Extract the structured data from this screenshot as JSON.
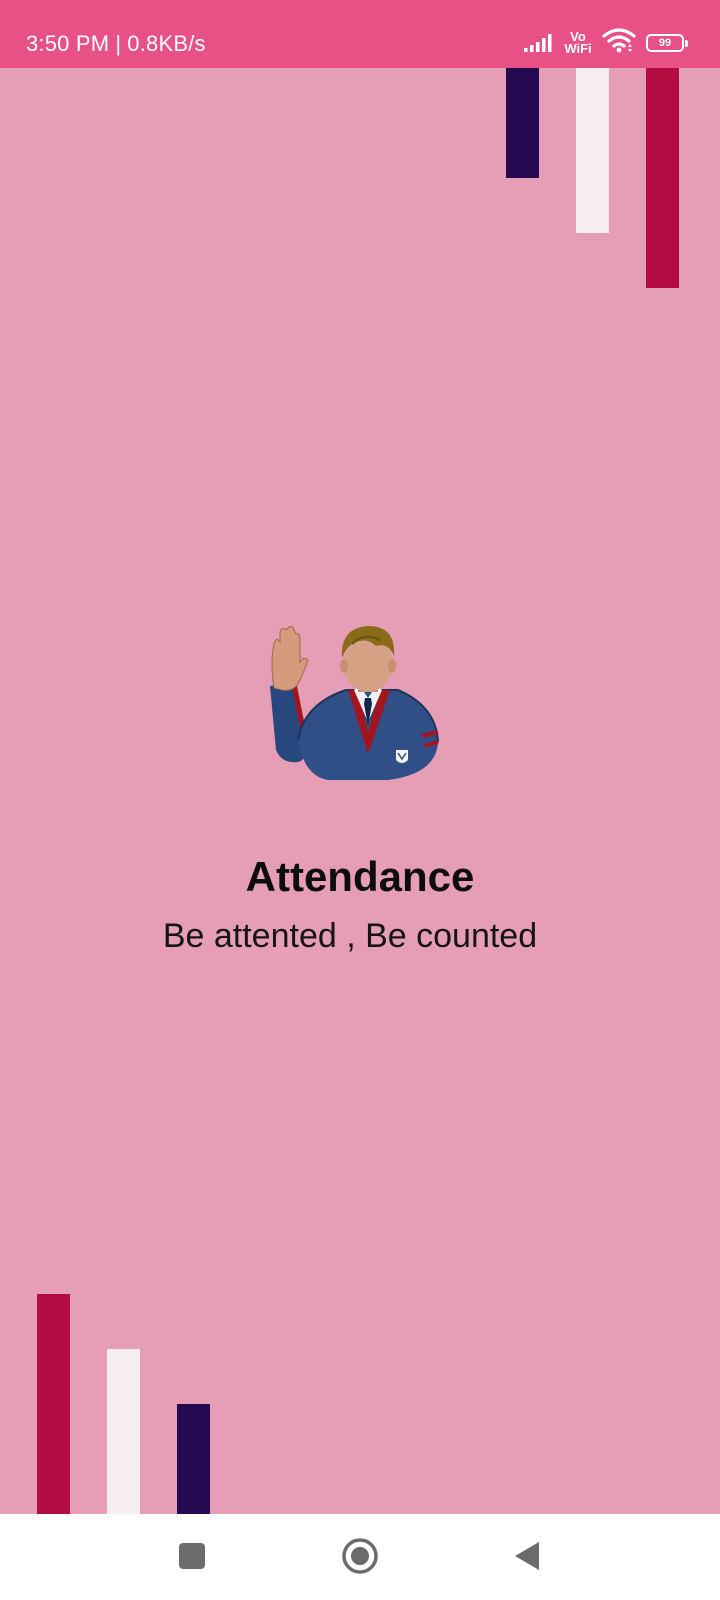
{
  "status_bar": {
    "time": "3:50 PM",
    "separator": "|",
    "speed": "0.8KB/s",
    "vowifi_top": "Vo",
    "vowifi_bottom": "WiFi",
    "battery": "99",
    "icons": [
      "signal-icon",
      "vowifi-icon",
      "wifi-icon",
      "battery-icon"
    ],
    "background": "#e85185"
  },
  "splash": {
    "title": "Attendance",
    "subtitle": "Be attented , Be counted",
    "logo_icon": "student-raising-hand-icon",
    "background": "#e69db6",
    "bar_colors": {
      "dark": "#250a52",
      "light": "#f7eef1",
      "crimson": "#b20c43"
    }
  },
  "nav_bar": {
    "buttons": [
      "recent-apps-button",
      "home-button",
      "back-button"
    ]
  }
}
